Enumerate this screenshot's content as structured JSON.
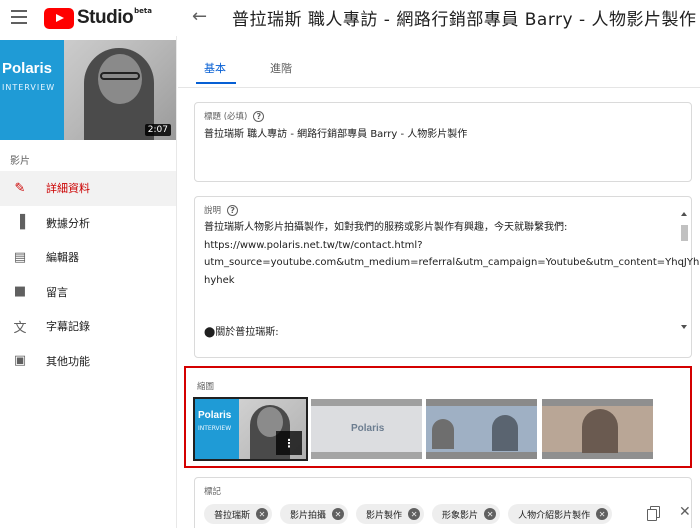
{
  "header": {
    "logo_text": "Studio",
    "logo_badge": "beta",
    "back_icon": "arrow-left-icon",
    "video_title": "普拉瑞斯 職人專訪 - 網路行銷部專員 Barry - 人物影片製作"
  },
  "sidebar": {
    "thumbnail": {
      "brand": "Polaris",
      "brand_sub": "INTERVIEW",
      "duration": "2:07"
    },
    "section_label": "影片",
    "items": [
      {
        "label": "詳細資料",
        "icon": "pencil-icon",
        "active": true
      },
      {
        "label": "數據分析",
        "icon": "bar-chart-icon",
        "active": false
      },
      {
        "label": "編輯器",
        "icon": "clapperboard-icon",
        "active": false
      },
      {
        "label": "留言",
        "icon": "comment-icon",
        "active": false
      },
      {
        "label": "字幕記錄",
        "icon": "translate-icon",
        "active": false
      },
      {
        "label": "其他功能",
        "icon": "more-features-icon",
        "active": false
      }
    ]
  },
  "tabs": [
    {
      "label": "基本",
      "active": true
    },
    {
      "label": "進階",
      "active": false
    }
  ],
  "title_field": {
    "label": "標題 (必填)",
    "value": "普拉瑞斯 職人專訪 - 網路行銷部專員 Barry - 人物影片製作"
  },
  "description_field": {
    "label": "說明",
    "lines": [
      "普拉瑞斯人物影片拍攝製作，如對我們的服務或影片製作有興趣，今天就聯繫我們:",
      "https://www.polaris.net.tw/tw/contact.html?",
      "utm_source=youtube.com&utm_medium=referral&utm_campaign=Youtube&utm_content=YhqJYh",
      "hyhek",
      "",
      "",
      "⬤關於普拉瑞斯:"
    ]
  },
  "thumbnails": {
    "label": "縮圖",
    "items": [
      {
        "brand": "Polaris",
        "brand_sub": "INTERVIEW",
        "selected": true,
        "more_icon": "more-vert-icon"
      },
      {
        "brand": "Polaris",
        "selected": false
      },
      {
        "selected": false
      },
      {
        "selected": false
      }
    ]
  },
  "tags_field": {
    "label": "標記",
    "tags": [
      "普拉瑞斯",
      "影片拍攝",
      "影片製作",
      "形象影片",
      "人物介紹影片製作"
    ]
  },
  "colors": {
    "accent_red": "#cc0000",
    "tab_blue": "#065fd4",
    "highlight_box": "#d40000"
  }
}
